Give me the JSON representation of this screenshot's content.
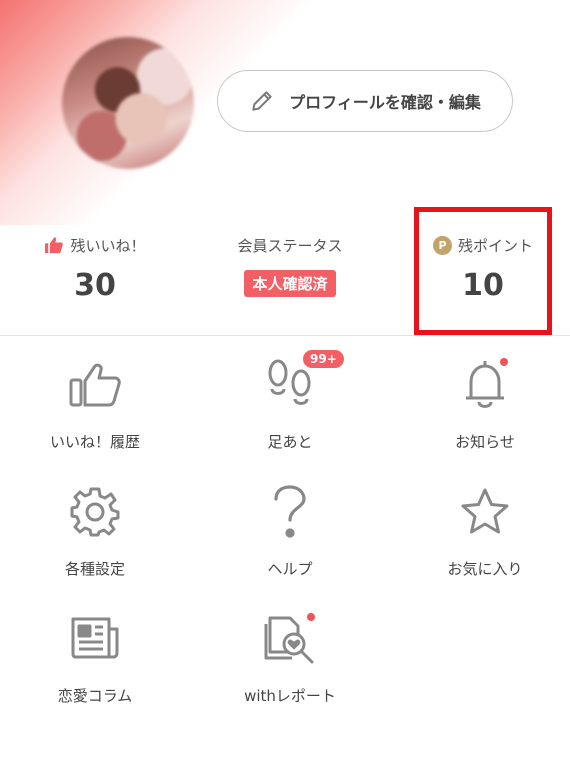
{
  "profile": {
    "edit_button_label": "プロフィールを確認・編集"
  },
  "stats": {
    "likes": {
      "label": "残いいね！",
      "value": "30"
    },
    "member": {
      "label": "会員ステータス",
      "badge": "本人確認済"
    },
    "points": {
      "label": "残ポイント",
      "icon_letter": "P",
      "value": "10"
    }
  },
  "menu": {
    "items": [
      {
        "label": "いいね！履歴",
        "icon": "thumbs-up-icon"
      },
      {
        "label": "足あと",
        "icon": "footprints-icon",
        "badge": "99+"
      },
      {
        "label": "お知らせ",
        "icon": "bell-icon"
      },
      {
        "label": "各種設定",
        "icon": "gear-icon"
      },
      {
        "label": "ヘルプ",
        "icon": "question-icon"
      },
      {
        "label": "お気に入り",
        "icon": "star-icon"
      },
      {
        "label": "恋愛コラム",
        "icon": "newspaper-icon"
      },
      {
        "label": "withレポート",
        "icon": "report-icon"
      }
    ]
  },
  "colors": {
    "accent": "#f26066",
    "highlight_box": "#e8121a",
    "point_icon": "#c2a36a",
    "icon_gray": "#888888"
  }
}
